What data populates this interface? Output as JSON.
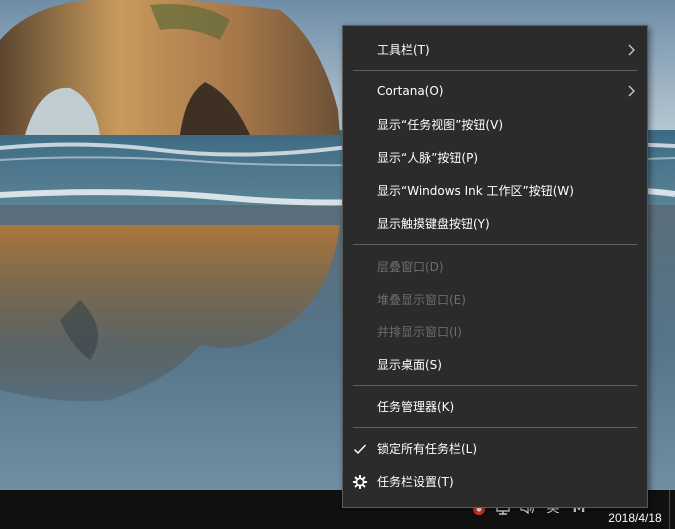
{
  "menu": {
    "items": [
      {
        "label": "工具栏(T)",
        "submenu": true,
        "enabled": true
      },
      {
        "label": "Cortana(O)",
        "submenu": true,
        "enabled": true
      },
      {
        "label": "显示“任务视图”按钮(V)",
        "enabled": true
      },
      {
        "label": "显示“人脉”按钮(P)",
        "enabled": true
      },
      {
        "label": "显示“Windows Ink 工作区”按钮(W)",
        "enabled": true
      },
      {
        "label": "显示触摸键盘按钮(Y)",
        "enabled": true
      },
      {
        "label": "层叠窗口(D)",
        "enabled": false
      },
      {
        "label": "堆叠显示窗口(E)",
        "enabled": false
      },
      {
        "label": "并排显示窗口(I)",
        "enabled": false
      },
      {
        "label": "显示桌面(S)",
        "enabled": true
      },
      {
        "label": "任务管理器(K)",
        "enabled": true
      },
      {
        "label": "锁定所有任务栏(L)",
        "enabled": true,
        "checked": true
      },
      {
        "label": "任务栏设置(T)",
        "enabled": true,
        "icon": "gear-icon"
      }
    ]
  },
  "taskbar": {
    "tray": {
      "chevron_glyph": "^",
      "ime_label": "英",
      "m_app_label": "M"
    },
    "clock_date": "2018/4/18"
  },
  "colors": {
    "menu_bg": "#2b2b2b",
    "menu_text": "#ffffff",
    "menu_disabled_text": "#6d6d6d",
    "taskbar_bg": "#101010"
  }
}
